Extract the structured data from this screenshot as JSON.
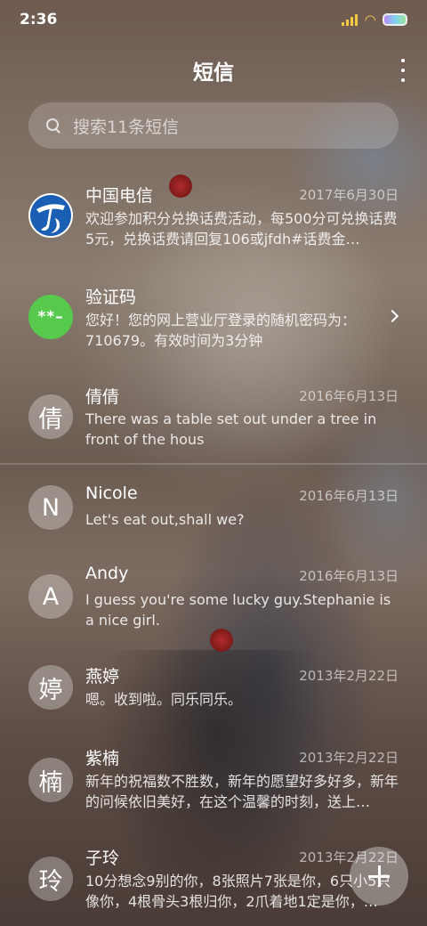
{
  "status_bar": {
    "time": "2:36"
  },
  "header": {
    "title": "短信"
  },
  "search": {
    "placeholder": "搜索11条短信"
  },
  "conversations": [
    {
      "avatar": "",
      "name": "中国电信",
      "date": "2017年6月30日",
      "preview": "欢迎参加积分兑换话费活动，每500分可兑换话费5元，兑换话费请回复106或jfdh#话费金…"
    },
    {
      "avatar": "**–",
      "name": "验证码",
      "date": "",
      "preview": "您好！您的网上营业厅登录的随机密码为：710679。有效时间为3分钟"
    },
    {
      "avatar": "倩",
      "name": "倩倩",
      "date": "2016年6月13日",
      "preview": "There was a table set out under a tree in front of the hous"
    },
    {
      "avatar": "N",
      "name": "Nicole",
      "date": "2016年6月13日",
      "preview": "Let's eat out,shall we?"
    },
    {
      "avatar": "A",
      "name": "Andy",
      "date": "2016年6月13日",
      "preview": "I guess you're some lucky guy.Stephanie is a nice girl."
    },
    {
      "avatar": "婷",
      "name": "燕婷",
      "date": "2013年2月22日",
      "preview": "嗯。收到啦。同乐同乐。"
    },
    {
      "avatar": "楠",
      "name": "紫楠",
      "date": "2013年2月22日",
      "preview": "新年的祝福数不胜数，新年的愿望好多好多，新年的问候依旧美好，在这个温馨的时刻，送上…"
    },
    {
      "avatar": "玲",
      "name": "子玲",
      "date": "2013年2月22日",
      "preview": "10分想念9别的你，8张照片7张是你，6只小5只像你，4根骨头3根归你，2爪着地1定是你，…"
    }
  ],
  "colors": {
    "verify_avatar": "#57c94d",
    "telecom_blue": "#1a5fb4"
  }
}
